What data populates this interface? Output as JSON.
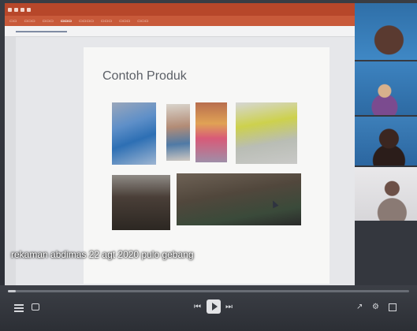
{
  "slide": {
    "title": "Contoh Produk"
  },
  "caption": {
    "text": "rekaman abdimas 22 agt 2020 pulo gebang"
  },
  "player": {
    "progress_fraction": 0.02
  },
  "colors": {
    "ppt_brand": "#b7472a",
    "slide_background": "#f7f7f6",
    "player_background": "#2c2f35"
  },
  "icons": [
    "list-icon",
    "subtitles-icon",
    "previous-icon",
    "play-icon",
    "next-icon",
    "share-icon",
    "settings-icon",
    "fullscreen-icon",
    "cursor-icon"
  ]
}
